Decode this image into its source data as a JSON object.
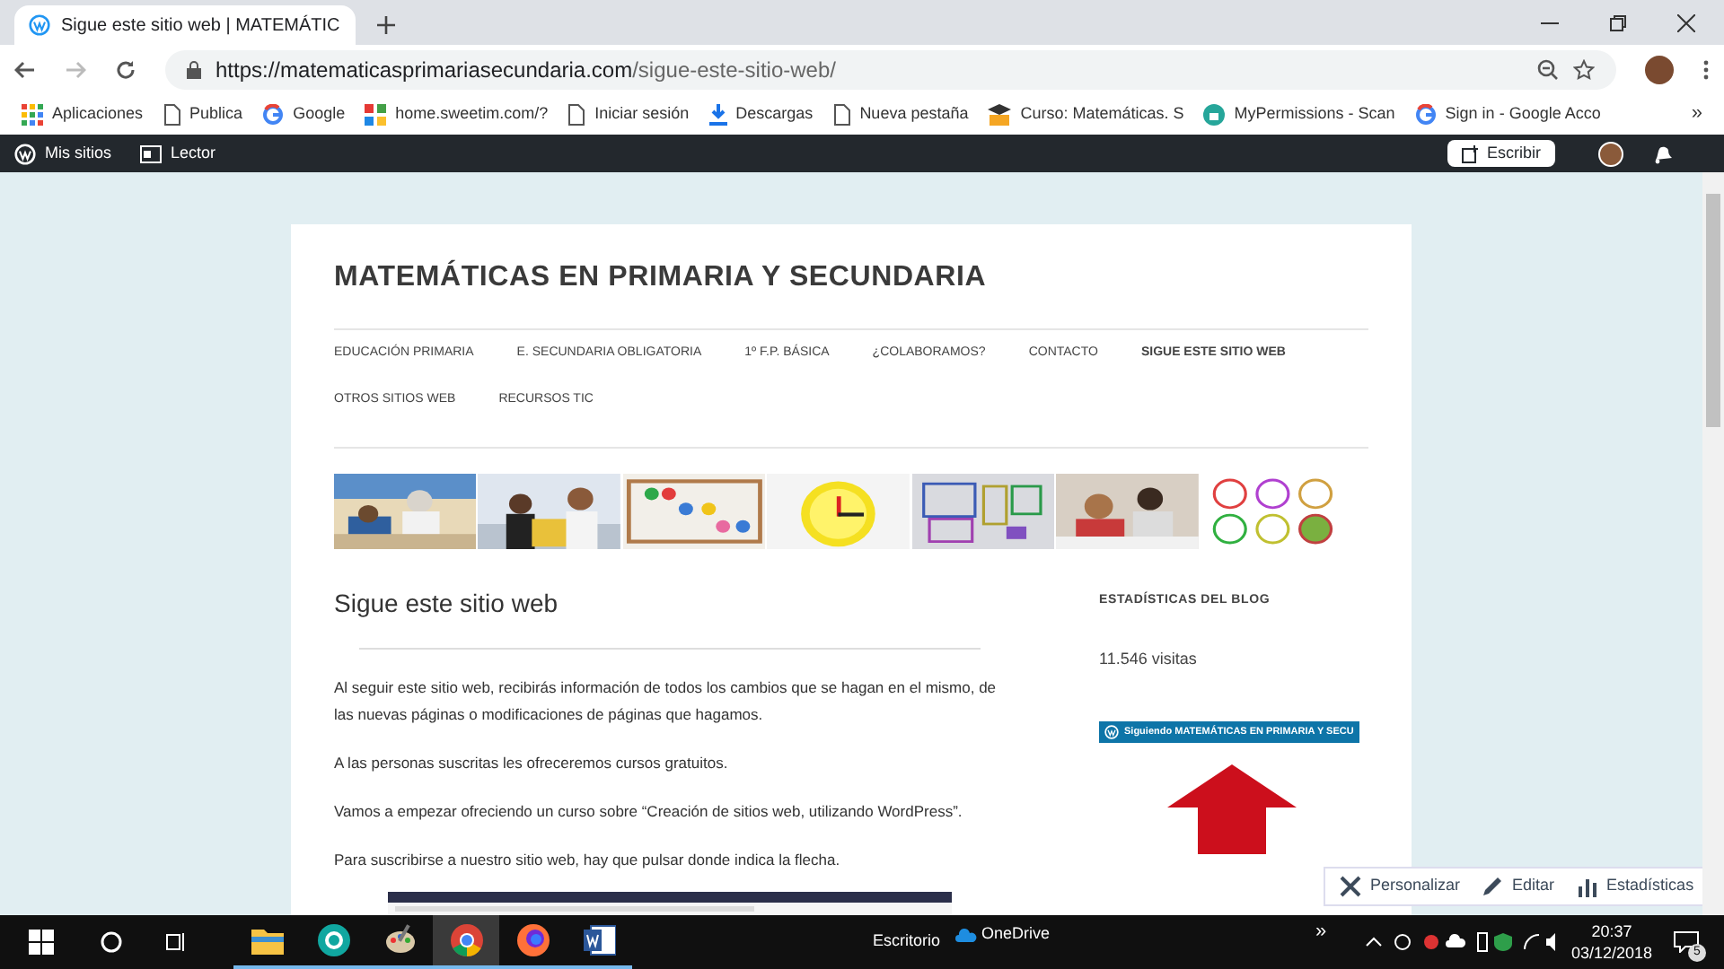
{
  "browser": {
    "tab_title": "Sigue este sitio web | MATEMÁTIC",
    "url_host": "https://matematicasprimariasecundaria.com",
    "url_path": "/sigue-este-sitio-web/",
    "bookmarks": [
      {
        "kind": "apps",
        "label": "Aplicaciones"
      },
      {
        "kind": "page",
        "label": "Publica"
      },
      {
        "kind": "google",
        "label": "Google"
      },
      {
        "kind": "tiles",
        "label": "home.sweetim.com/?"
      },
      {
        "kind": "page",
        "label": "Iniciar sesión"
      },
      {
        "kind": "download",
        "label": "Descargas"
      },
      {
        "kind": "page",
        "label": "Nueva pestaña"
      },
      {
        "kind": "cap",
        "label": "Curso: Matemáticas. S"
      },
      {
        "kind": "lock",
        "label": "MyPermissions - Scan"
      },
      {
        "kind": "google",
        "label": "Sign in - Google Acco"
      }
    ],
    "more": "»"
  },
  "admin_bar": {
    "left": [
      {
        "kind": "wp",
        "label": "Mis sitios"
      },
      {
        "kind": "reader",
        "label": "Lector"
      }
    ],
    "write": "Escribir"
  },
  "site": {
    "title": "MATEMÁTICAS EN PRIMARIA Y SECUNDARIA",
    "nav": [
      {
        "label": "EDUCACIÓN PRIMARIA",
        "selected": false
      },
      {
        "label": "E. SECUNDARIA OBLIGATORIA",
        "selected": false
      },
      {
        "label": "1º F.P. BÁSICA",
        "selected": false
      },
      {
        "label": "¿COLABORAMOS?",
        "selected": false
      },
      {
        "label": "CONTACTO",
        "selected": false
      },
      {
        "label": "SIGUE ESTE SITIO WEB",
        "selected": true
      },
      {
        "label": "OTROS SITIOS WEB",
        "selected": false
      },
      {
        "label": "RECURSOS TIC",
        "selected": false
      }
    ],
    "page_title": "Sigue este sitio web",
    "paragraphs": [
      "Al seguir este sitio web, recibirás información de todos los cambios que se hagan en el mismo, de las nuevas páginas o modificaciones de páginas que hagamos.",
      "A las personas suscritas les ofreceremos cursos gratuitos.",
      "Vamos a empezar ofreciendo un curso sobre “Creación de sitios web, utilizando WordPress”.",
      "Para suscribirse a nuestro sitio web, hay que pulsar donde indica la flecha."
    ],
    "sidebar": {
      "heading": "ESTADÍSTICAS DEL BLOG",
      "visits": "11.546 visitas",
      "follow": "Siguiendo MATEMÁTICAS EN PRIMARIA Y SECU"
    }
  },
  "floating_bar": [
    {
      "kind": "tools",
      "label": "Personalizar"
    },
    {
      "kind": "pencil",
      "label": "Editar"
    },
    {
      "kind": "stats",
      "label": "Estadísticas"
    }
  ],
  "taskbar": {
    "apps": [
      {
        "kind": "explorer",
        "selected": false
      },
      {
        "kind": "eset",
        "selected": false
      },
      {
        "kind": "paint",
        "selected": false
      },
      {
        "kind": "chrome",
        "selected": true
      },
      {
        "kind": "firefox",
        "selected": false
      },
      {
        "kind": "word",
        "selected": false
      }
    ],
    "desktop": "Escritorio",
    "onedrive": "OneDrive",
    "chevron": "»",
    "time": "20:37",
    "date": "03/12/2018",
    "notifications": "5"
  }
}
